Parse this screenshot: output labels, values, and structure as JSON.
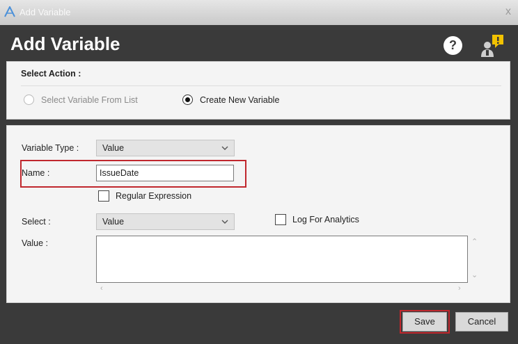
{
  "window": {
    "title": "Add Variable",
    "close_symbol": "x"
  },
  "header": {
    "heading": "Add Variable",
    "help_symbol": "?"
  },
  "action": {
    "label": "Select Action :",
    "options": [
      {
        "label": "Select Variable From List",
        "selected": false,
        "enabled": false
      },
      {
        "label": "Create New Variable",
        "selected": true,
        "enabled": true
      }
    ]
  },
  "form": {
    "variable_type": {
      "label": "Variable Type :",
      "value": "Value"
    },
    "name": {
      "label": "Name :",
      "value": "IssueDate"
    },
    "regex": {
      "label": "Regular Expression",
      "checked": false
    },
    "select": {
      "label": "Select :",
      "value": "Value"
    },
    "log_analytics": {
      "label": "Log For Analytics",
      "checked": false
    },
    "value": {
      "label": "Value :",
      "value": ""
    }
  },
  "buttons": {
    "save": "Save",
    "cancel": "Cancel"
  },
  "colors": {
    "dark_bg": "#3a3a3a",
    "highlight": "#c0272d",
    "alert": "#f2c200"
  },
  "icons": [
    "app-logo-icon",
    "close-icon",
    "help-icon",
    "user-alert-icon",
    "chevron-down-icon",
    "scroll-up-icon",
    "scroll-down-icon",
    "scroll-left-icon",
    "scroll-right-icon"
  ]
}
